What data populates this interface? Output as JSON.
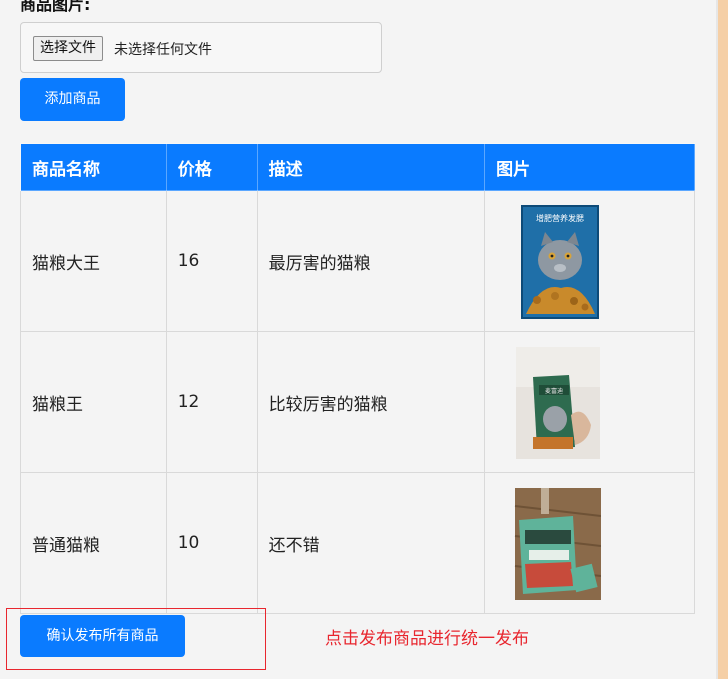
{
  "form": {
    "image_label": "商品图片:",
    "file_button": "选择文件",
    "file_status": "未选择任何文件",
    "add_button": "添加商品"
  },
  "table": {
    "headers": [
      "商品名称",
      "价格",
      "描述",
      "图片"
    ],
    "rows": [
      {
        "name": "猫粮大王",
        "price": "16",
        "desc": "最厉害的猫粮",
        "img_text": "增肥营养发腮"
      },
      {
        "name": "猫粮王",
        "price": "12",
        "desc": "比较厉害的猫粮",
        "img_text": "麦富迪"
      },
      {
        "name": "普通猫粮",
        "price": "10",
        "desc": "还不错",
        "img_text": ""
      }
    ]
  },
  "publish_button": "确认发布所有商品",
  "annotation": "点击发布商品进行统一发布",
  "colors": {
    "primary": "#0a7bff",
    "annotation_red": "#e8262e",
    "side_strip": "#f5cfa6"
  }
}
